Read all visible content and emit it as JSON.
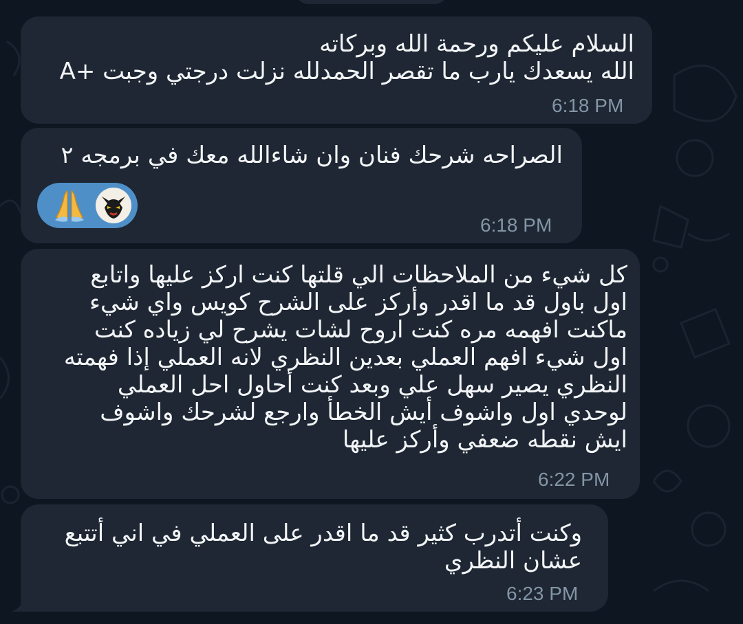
{
  "messages": [
    {
      "lines": [
        "السلام عليكم ورحمة الله وبركاته",
        "الله يسعدك يارب ما تقصر الحمدلله نزلت درجتي وجبت +A"
      ],
      "time": "6:18 PM"
    },
    {
      "lines": [
        "الصراحه شرحك فنان وان شاءالله معك في برمجه ٢"
      ],
      "time": "6:18 PM",
      "reactions": [
        {
          "icon": "folded-hands-icon",
          "emoji": "🙏"
        },
        {
          "icon": "cat-avatar-icon"
        }
      ]
    },
    {
      "lines": [
        "كل شيء من الملاحظات الي قلتها كنت اركز عليها واتابع",
        "اول باول قد ما اقدر وأركز على الشرح كويس واي شيء",
        "ماكنت افهمه مره كنت اروح لشات يشرح لي زياده كنت",
        "اول شيء افهم العملي بعدين النظري لانه العملي إذا فهمته",
        "النظري يصير سهل علي وبعد كنت أحاول احل العملي",
        "لوحدي اول واشوف أيش الخطأ وارجع لشرحك واشوف",
        "ايش نقطه ضعفي وأركز عليها"
      ],
      "time": "6:22 PM"
    },
    {
      "lines": [
        "وكنت أتدرب كثير قد ما اقدر على العملي في اني أتتبع",
        "عشان النظري"
      ],
      "time": "6:23 PM"
    }
  ],
  "colors": {
    "background": "#0e1621",
    "bubble": "#1e2733",
    "text": "#f2f4f6",
    "time": "#8495a6",
    "reaction_pill": "#4e8fc8"
  }
}
